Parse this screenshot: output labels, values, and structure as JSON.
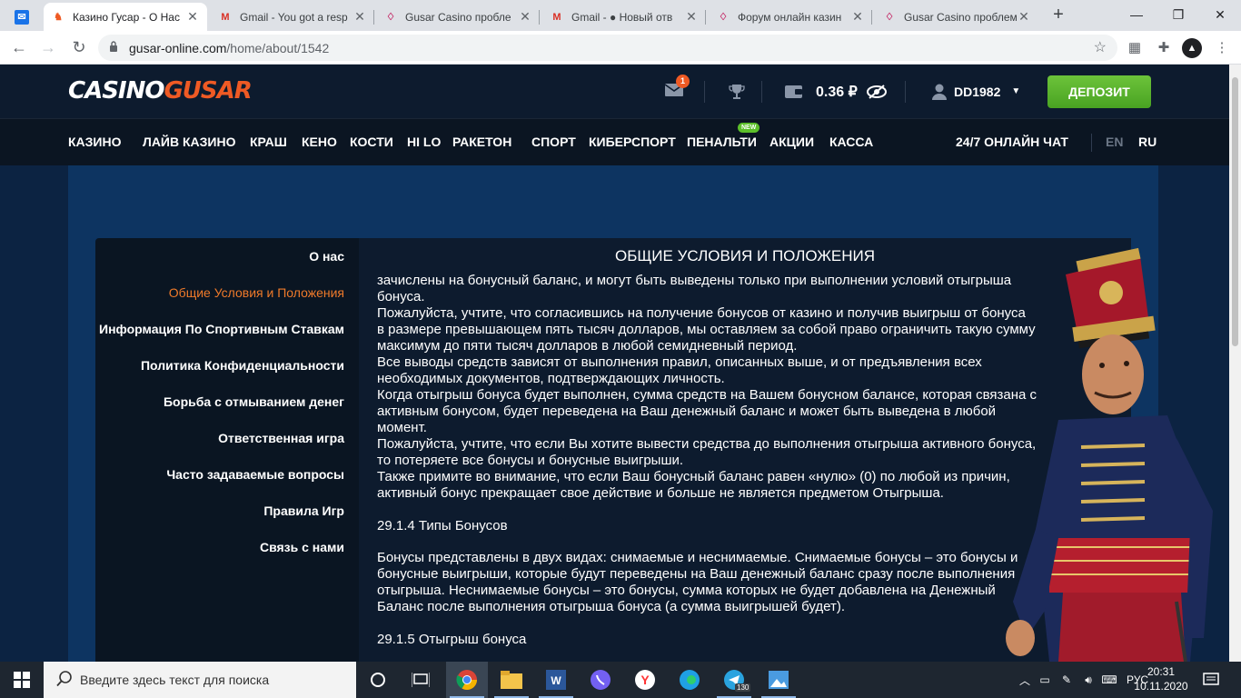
{
  "browser": {
    "tabs": [
      {
        "title": "",
        "icon": "mail-app-icon",
        "active": false
      },
      {
        "title": "Казино Гусар - О Нас",
        "icon": "hussar-favicon",
        "active": true
      },
      {
        "title": "Gmail - You got a resp",
        "icon": "gmail-icon",
        "active": false
      },
      {
        "title": "Gusar Casino пробле",
        "icon": "forum-icon",
        "active": false
      },
      {
        "title": "Gmail - ● Новый отв",
        "icon": "gmail-icon",
        "active": false
      },
      {
        "title": "Форум онлайн казин",
        "icon": "forum-icon",
        "active": false
      },
      {
        "title": "Gusar Casino проблем",
        "icon": "forum-icon",
        "active": false
      }
    ],
    "url_host": "gusar-online.com",
    "url_path": "/home/about/1542"
  },
  "site": {
    "logo_part1": "CASINO",
    "logo_part2": "GUSAR",
    "mail_count": "1",
    "balance": "0.36 ₽",
    "username": "DD1982",
    "deposit_label": "ДЕПОЗИТ",
    "nav": [
      "КАЗИНО",
      "ЛАЙВ КАЗИНО",
      "КРАШ",
      "КЕНО",
      "КОСТИ",
      "HI LO",
      "РАКЕТОН",
      "СПОРТ",
      "КИБЕРСПОРТ",
      "ПЕНАЛЬТИ",
      "АКЦИИ",
      "КАССА"
    ],
    "nav_badge": "NEW",
    "chat_label": "24/7 ОНЛАЙН ЧАТ",
    "lang_en": "EN",
    "lang_ru": "RU"
  },
  "sidebar": {
    "items": [
      "О нас",
      "Общие Условия и Положения",
      "Информация По Спортивным Ставкам",
      "Политика Конфиденциальности",
      "Борьба с отмыванием денег",
      "Ответственная игра",
      "Часто задаваемые вопросы",
      "Правила Игр",
      "Связь с нами"
    ],
    "active_index": 1
  },
  "article": {
    "title": "ОБЩИЕ УСЛОВИЯ И ПОЛОЖЕНИЯ",
    "lines": [
      "зачислены на бонусный баланс, и могут быть выведены только при выполнении условий отыгрыша",
      "бонуса.",
      "Пожалуйста, учтите, что согласившись на получение бонусов от казино и получив выигрыш от бонуса",
      "в размере превышающем пять тысяч долларов, мы оставляем за собой право ограничить такую сумму",
      "максимум до пяти тысяч долларов в любой семидневный период.",
      "Все выводы средств зависят от выполнения правил, описанных выше, и от предъявления всех",
      "необходимых документов, подтверждающих личность.",
      "Когда отыгрыш бонуса будет выполнен, сумма средств на Вашем бонусном балансе, которая связана с",
      "активным бонусом, будет переведена на Ваш денежный баланс и может быть выведена в любой",
      "момент.",
      "Пожалуйста, учтите, что если Вы хотите вывести средства до выполнения отыгрыша активного бонуса,",
      "то потеряете все бонусы и бонусные выигрыши.",
      "Также примите во внимание, что если Ваш бонусный баланс равен «нулю» (0) по любой из причин,",
      "активный бонус прекращает свое действие и больше не является предметом Отыгрыша."
    ],
    "heading_types": "29.1.4 Типы Бонусов",
    "lines2": [
      "Бонусы представлены в двух видах: снимаемые и неснимаемые. Снимаемые бонусы – это бонусы и",
      "бонусные выигрыши, которые будут переведены на Ваш денежный баланс сразу после выполнения",
      "отыгрыша. Неснимаемые бонусы – это бонусы, сумма которых не будет добавлена на Денежный",
      "Баланс после выполнения отыгрыша бонуса (а сумма выигрышей будет)."
    ],
    "heading_wager": "29.1.5 Отыгрыш бонуса"
  },
  "taskbar": {
    "search_placeholder": "Введите здесь текст для поиска",
    "lang": "РУС",
    "time": "20:31",
    "date": "10.11.2020",
    "telegram_badge": "130"
  },
  "colors": {
    "accent": "#ef5a24",
    "deposit": "#5cb82e",
    "header_bg": "#0d1b2e",
    "page_bg": "#0c2342"
  }
}
